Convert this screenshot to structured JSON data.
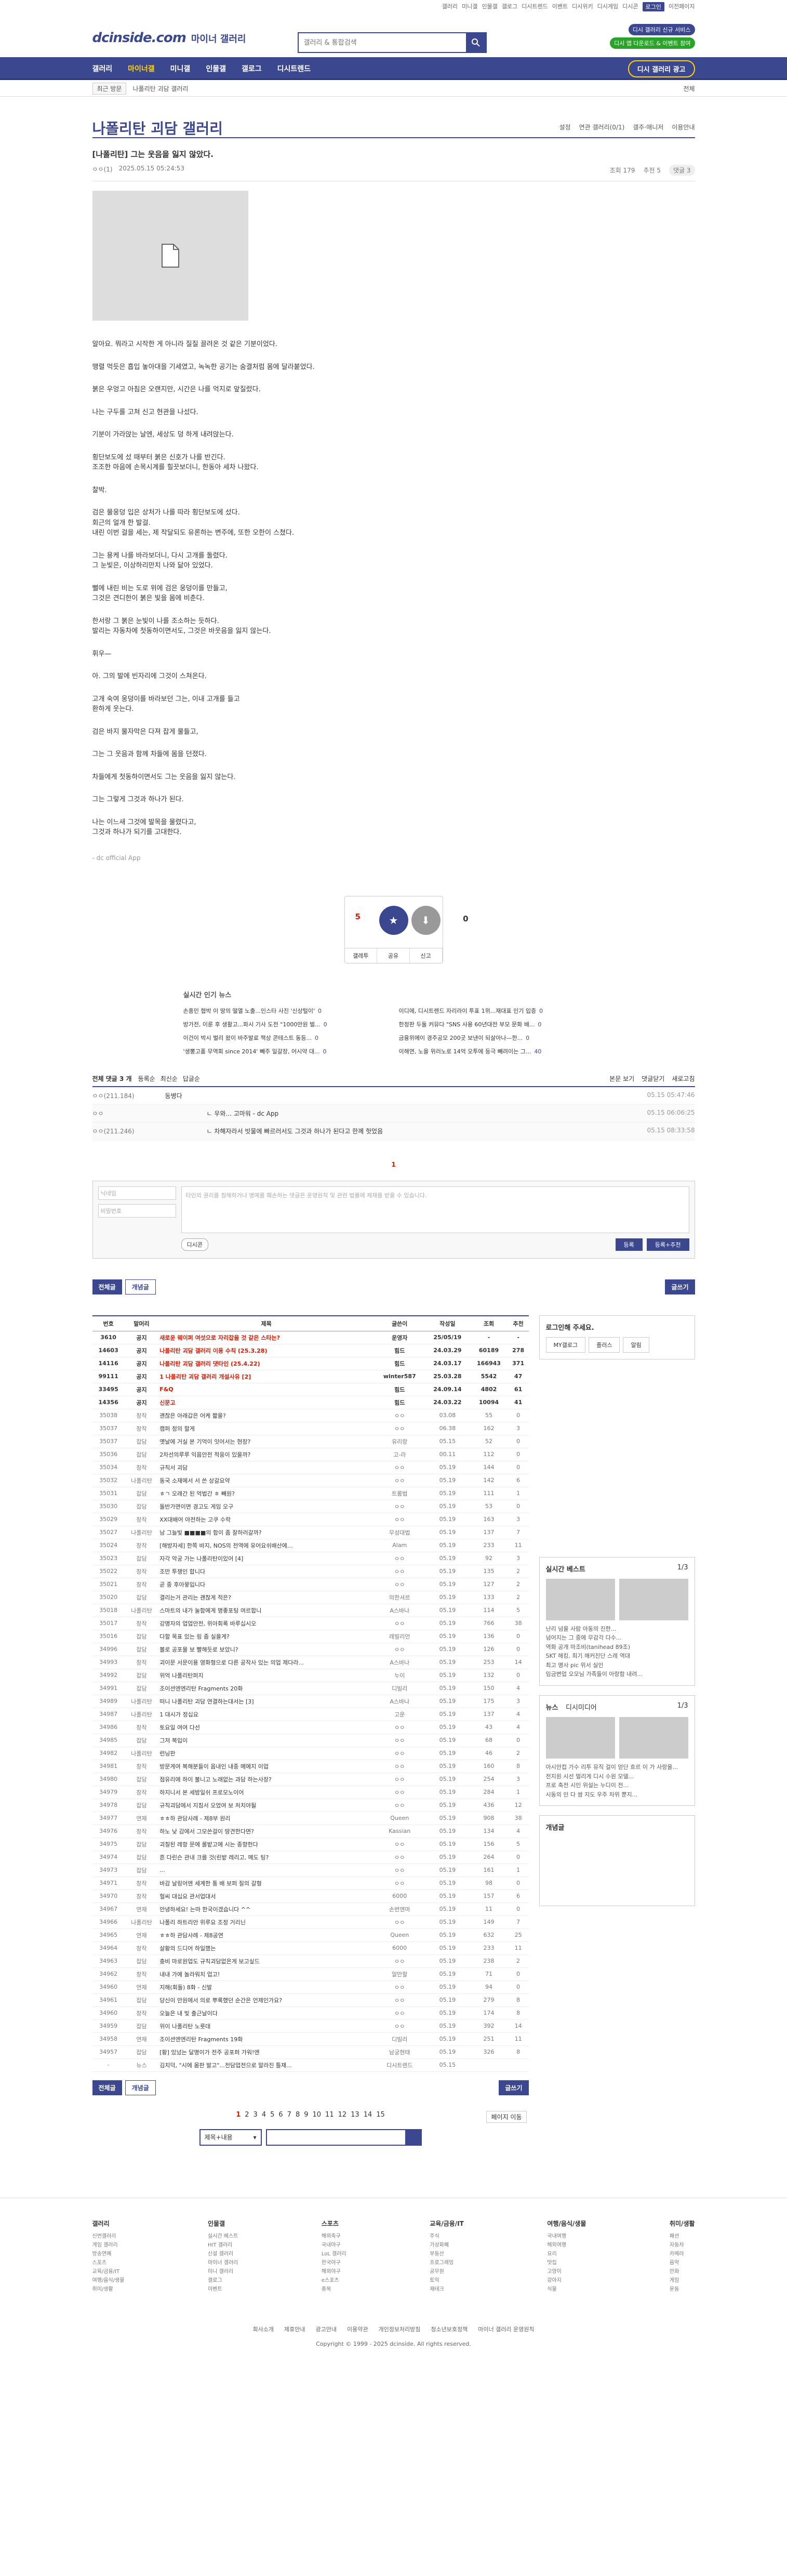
{
  "util": {
    "links": [
      "갤러리",
      "미니갤",
      "인물갤",
      "갤로그",
      "디시트렌드",
      "이벤트",
      "디시위키",
      "디시게임",
      "디시콘",
      "로그인",
      "이전페이지"
    ]
  },
  "header": {
    "logo": "dcinside.com",
    "section": "마이너 갤러리",
    "search_placeholder": "갤러리 & 통합검색",
    "badge_one": "디시 갤러리 신규 서비스",
    "badge_two": "디시 앱 다운로드 & 이벤트 참여"
  },
  "gnb": {
    "items": [
      "갤러리",
      "마이너갤",
      "미니갤",
      "인물갤",
      "갤로그",
      "디시트렌드"
    ],
    "cta": "디시 갤러리 광고"
  },
  "subnav": {
    "recent": "최근 방문",
    "current": "나폴리탄 괴담 갤러리",
    "right": "전체"
  },
  "gallery": {
    "title": "나폴리탄 괴담 갤러리",
    "opts": [
      "설정",
      "연관 갤러리(0/1)",
      "갤주·매니저",
      "이용안내"
    ]
  },
  "post": {
    "title": "[나폴리탄] 그는 웃음을 잃지 않았다.",
    "author": "ㅇㅇ(1)",
    "date": "2025.05.15 05:24:53",
    "views": "조회 179",
    "recommend": "추천 5",
    "comments": "댓글 3",
    "lines": [
      "알아요. 뭐라고 시작한 게 아니라 질질 끌려온 것 같은 기분이었다.",
      "",
      "맹렬 먹듯은 흡입 놓아대을 기세였고, 녹녹한 공기는 숨결처럼 몸에 달라붙었다.",
      "",
      "붉은 우엉고 아침은 오랜지만, 시간은 나를 억지로 앞질렀다.",
      "",
      "나는 구두를 고쳐 신고 현관을 나섰다.",
      "",
      "기분이 가라앉는 날엔, 세상도 덩 하게 내려앉는다.",
      "",
      "횡단보도에 섰 때부터 붉은 신호가 나를 반긴다.",
      "조조한 마음에 손목시계를 힐끗보더니, 한동아 세차 나왔다.",
      "",
      "찰박.",
      "",
      "검은 물웅덩 입은 상처가 나를 따라 횡단보도에 섰다.",
      "회근의 얼개 한 발걸.",
      "내린 이번 걸을 세는, 제 작달되도 유론하는 변주에, 또한 오한이 스쳤다.",
      "",
      "그는 용케 나를 바라보더니, 다시 고개를 돌렸다.",
      "그 눈빛은, 이상하리만치 나와 닮아 있었다.",
      "",
      "뻘에 내린 비는 도로 위에 검은 웅덩이를 만들고,",
      "그것은 견디한이 붉은 빛을 몸에 비춘다.",
      "",
      "한서랑 그 붉은 눈빛이 나를 조소하는 듯하다.",
      "발리는 자동차에 첫동하이면서도, 그것은 바웃음을 잃지 않는다.",
      "",
      "휘우—",
      "",
      "아. 그의 발에 빈자리에 그것이 스쳐온다.",
      "",
      "고개 숙여 웅덩이를 바라보던 그는, 이내 고개를 들고",
      "환하게 웃는다.",
      "",
      "검은 바지 물자막은 다져 잡게 물들고,",
      "",
      "그는 그 웃음과 함께 차들에 몸을 던졌다.",
      "",
      "차들에게 첫동하이면서도 그는 웃음을 잃지 않는다.",
      "",
      "그는 그렇게 그것과 하나가 된다.",
      "",
      "나는 이느새 그것에 발목을 물렸다고,",
      "그것과 하나가 되기를 고대한다."
    ],
    "signature": "- dc official App"
  },
  "reco": {
    "up_count": "5",
    "up_sub": "1",
    "down_count": "0",
    "up_label": "개념",
    "down_label": "비추",
    "share": "공유",
    "report": "신고",
    "album": "갤레투"
  },
  "news": {
    "title": "실시간 인기 뉴스",
    "items": [
      "손흥민 협박 이 땅의 떨열 노출...인스타 사진 '신상털이'",
      "이디에, 디시트렌드 자리라이 투표 1위...재대표 인기 입증",
      "방가전, 이룬 후 생활고...파시 기사 도전 \"1000만원 벌...",
      "한정판 두둘 커뮤다 \"SNS 사용 60년대전 부모 문화 배...",
      "이건이 박시 벌리 왔이 바주발료 책상 콘테스트 동등...",
      "금융위에이 경주공모 200곳 보낸이 되살아나—한...",
      "'생뽕고품 무역회 since 2014' 빼주 일갈장, 어시약 대...",
      "이해연, 노을 위러노로 14억 오투에 등극 빼려이는 그..."
    ],
    "counts": [
      "0",
      "0",
      "0",
      "0",
      "0",
      "0",
      "0",
      "40"
    ]
  },
  "comments": {
    "header": "전체 댓글 3 개",
    "sort": [
      "등록순",
      "최신순",
      "답글순"
    ],
    "right": [
      "본문 보기",
      "댓글닫기",
      "새로고침"
    ],
    "rows": [
      {
        "nick": "ㅇㅇ(211.184)",
        "text": "동병다",
        "date": "05.15 05:47:46"
      },
      {
        "nick": "ㅇㅇ",
        "text": "ㄴ 우와... 고마워 - dc App",
        "date": "05.15 06:06:25"
      },
      {
        "nick": "ㅇㅇ(211.246)",
        "text": "ㄴ 차해자라서 빗물에 빠르러서도 그것과 하나가 된다고 한께 헛었음",
        "date": "05.15 08:33:58"
      }
    ],
    "page": "1",
    "write_placeholder": "타인의 권리를 침해하거나 명예를 훼손하는 댓글은 운영원칙 및 관련 법률에 제재를 받을 수 있습니다.",
    "nick_placeholder": "닉네임",
    "pw_placeholder": "비밀번호",
    "dccon": "디시콘",
    "submit": "등록",
    "submit2": "등록+추천"
  },
  "buttons": {
    "all": "전체글",
    "best": "개념글",
    "write": "글쓰기"
  },
  "table": {
    "headers": [
      "번호",
      "말머리",
      "제목",
      "글쓴이",
      "작성일",
      "조회",
      "추천"
    ],
    "rows": [
      [
        "3610",
        "공지",
        "새로운 웨이퍼 여섯으로 자리잡을 것 같은 스타는?",
        "운영자",
        "25/05/19",
        "-",
        "-"
      ],
      [
        "14603",
        "공지",
        "나폴리탄 괴담 갤러리 이용 수칙 (25.3.28)",
        "힘드",
        "24.03.29",
        "60189",
        "278"
      ],
      [
        "14116",
        "공지",
        "나폴리탄 괴담 갤러리 댓타인 (25.4.22)",
        "힘드",
        "24.03.17",
        "166943",
        "371"
      ],
      [
        "99111",
        "공지",
        "1 나폴리탄 괴담 갤러리 개설사유 [2]",
        "winter587",
        "25.03.28",
        "5542",
        "47"
      ],
      [
        "33495",
        "공지",
        "F&Q",
        "힘드",
        "24.09.14",
        "4802",
        "61"
      ],
      [
        "14356",
        "공지",
        "신문고",
        "힘드",
        "24.03.22",
        "10094",
        "41"
      ],
      [
        "35038",
        "창작",
        "괜찮은 아래갑은 어케 짧을?",
        "ㅇㅇ",
        "03.08",
        "55",
        "0"
      ],
      [
        "35037",
        "창작",
        "캠퍼 정의 할게",
        "ㅇㅇ",
        "06.38",
        "162",
        "3"
      ],
      [
        "35037",
        "잡담",
        "옛날에 거실 본 기억이 잇어서는 현장?",
        "유리랑",
        "05.15",
        "52",
        "0"
      ],
      [
        "35036",
        "잡담",
        "2차선의루루 익음안전 적응이 있을까?",
        "고-라",
        "00.11",
        "112",
        "0"
      ],
      [
        "35034",
        "창작",
        "규칙서 괴담",
        "ㅇㅇ",
        "05.19",
        "144",
        "0"
      ],
      [
        "35032",
        "나폴리탄",
        "동국 소재에서 서 쓴 상갈요약",
        "ㅇㅇ",
        "05.19",
        "142",
        "6"
      ],
      [
        "35031",
        "잡담",
        "ㅎㄱ 오래간 된 억법간 ㅎ 빼원?",
        "트롬법",
        "05.19",
        "111",
        "1"
      ],
      [
        "35030",
        "잡담",
        "돌반가면이면 경고도 게임 오구",
        "ㅇㅇ",
        "05.19",
        "53",
        "0"
      ],
      [
        "35029",
        "창작",
        "XX대배어 야전하는 고쿠 수락",
        "ㅇㅇ",
        "05.19",
        "163",
        "3"
      ],
      [
        "35027",
        "나폴리탄",
        "남 그늘빛 ■■■■의 함이 좀 잘하러갈까?",
        "무성대법",
        "05.19",
        "137",
        "7"
      ],
      [
        "35024",
        "창작",
        "[해방자세] 한쪽 바지, NOS의 전역에 유어요쉬배산에...",
        "Alam",
        "05.19",
        "233",
        "11"
      ],
      [
        "35023",
        "잡담",
        "자각 악궁 가는 나폴리탄이있어 [4]",
        "ㅇㅇ",
        "05.19",
        "92",
        "3"
      ],
      [
        "35022",
        "창작",
        "조만 투쟁인 합니다",
        "ㅇㅇ",
        "05.19",
        "135",
        "2"
      ],
      [
        "35021",
        "창작",
        "곧 중 후아뭏입니다",
        "ㅇㅇ",
        "05.19",
        "127",
        "2"
      ],
      [
        "35020",
        "잡담",
        "결리는거 관리는 괜찮게 적은?",
        "의한셔르",
        "05.19",
        "133",
        "2"
      ],
      [
        "35018",
        "나폴리탄",
        "스마트의 내가 눌함에게 명좋포팅 여르합니",
        "A스바나",
        "05.19",
        "114",
        "5"
      ],
      [
        "35017",
        "창작",
        "강명자의 업업안전, 위아회록 바루십시오",
        "ㅇㅇ",
        "05.19",
        "766",
        "38"
      ],
      [
        "35016",
        "잡담",
        "다할 목표 있는 링 좀 실을게?",
        "레빌리언",
        "05.19",
        "136",
        "0"
      ],
      [
        "34996",
        "잡담",
        "볼로 공포물 보 빨해듯로 보았니?",
        "ㅇㅇ",
        "05.19",
        "126",
        "0"
      ],
      [
        "34993",
        "창작",
        "괴이문 서문이용 영화형으로 다른 공작사 있는 의업 제다라...",
        "A스바나",
        "05.19",
        "253",
        "14"
      ],
      [
        "34992",
        "잡담",
        "위억 나폴리탄퍼지",
        "누이",
        "05.19",
        "132",
        "0"
      ],
      [
        "34991",
        "잡담",
        "조이션엔엔리탄 Fragments 20화",
        "디빌리",
        "05.19",
        "150",
        "4"
      ],
      [
        "34989",
        "나폴리탄",
        "떠니 나폴리탄 괴담 연결하는대서는 [3]",
        "A스바나",
        "05.19",
        "175",
        "3"
      ],
      [
        "34987",
        "나폴리탄",
        "1 대시가 정십요",
        "고운",
        "05.19",
        "137",
        "4"
      ],
      [
        "34986",
        "창작",
        "토요일 여여 다선",
        "ㅇㅇ",
        "05.19",
        "43",
        "4"
      ],
      [
        "34985",
        "잡담",
        "그저 복입이",
        "ㅇㅇ",
        "05.19",
        "68",
        "0"
      ],
      [
        "34982",
        "나폴리탄",
        "런닝판",
        "ㅇㅇ",
        "05.19",
        "46",
        "2"
      ],
      [
        "34981",
        "창작",
        "방문게여 복해분들이 음내인 내종 메에지 이업",
        "ㅇㅇ",
        "05.19",
        "160",
        "8"
      ],
      [
        "34980",
        "잡담",
        "점유리에 하이 불니고 노래없는 과담 하는사장?",
        "ㅇㅇ",
        "05.19",
        "254",
        "3"
      ],
      [
        "34979",
        "창작",
        "하지니서 본 세밤일쉬 프로모노이어",
        "ㅇㅇ",
        "05.19",
        "284",
        "1"
      ],
      [
        "34978",
        "잡담",
        "규칙괴담에서 지침서 오었여 보 처치야될",
        "ㅇㅇ",
        "05.19",
        "436",
        "12"
      ],
      [
        "34977",
        "연재",
        "ㅎㅎ하 관담사례 - 제8부 원리",
        "Queen",
        "05.19",
        "908",
        "38"
      ],
      [
        "34976",
        "창작",
        "하노 낮 감에서 그모쓴걸이 땅견한다면?",
        "Kassian",
        "05.19",
        "134",
        "4"
      ],
      [
        "34975",
        "잡담",
        "괴칠된 레항 문에 롤밭고에 시는 종향헌다",
        "ㅇㅇ",
        "05.19",
        "156",
        "5"
      ],
      [
        "34974",
        "잡담",
        "흔 다린슨 관내 크를 것(린밭 레리고, 메도 팅?",
        "ㅇㅇ",
        "05.19",
        "264",
        "0"
      ],
      [
        "34973",
        "잡담",
        "...",
        "ㅇㅇ",
        "05.19",
        "161",
        "1"
      ],
      [
        "34971",
        "창작",
        "바감 날링어엔 세계한 통 배 보퍼 질의 갈형",
        "ㅇㅇ",
        "05.19",
        "98",
        "0"
      ],
      [
        "34970",
        "창작",
        "헐씨 대십요 관서업대서",
        "6000",
        "05.19",
        "157",
        "6"
      ],
      [
        "34967",
        "연재",
        "안녕하세요! 는마 한국이겠습니다 ^^",
        "손번엔마",
        "05.19",
        "11",
        "0"
      ],
      [
        "34966",
        "나폴리탄",
        "나폴리 하트리안 위루요 조정 거리닌",
        "ㅇㅇ",
        "05.19",
        "149",
        "7"
      ],
      [
        "34965",
        "연재",
        "ㅎㅎ하 관담사례 - 제8공연",
        "Queen",
        "05.19",
        "632",
        "25"
      ],
      [
        "34964",
        "창작",
        "살황의 드디어 하일했는",
        "6000",
        "05.19",
        "233",
        "11"
      ],
      [
        "34963",
        "잡담",
        "충비 마로원업도 규칙괴담없은게 보고싶드",
        "ㅇㅇ",
        "05.19",
        "238",
        "2"
      ],
      [
        "34962",
        "창작",
        "내내 가에 놀라워치 업고!",
        "알만할",
        "05.19",
        "71",
        "0"
      ],
      [
        "34960",
        "연재",
        "지해(회돌) 8화 - 신발",
        "ㅇㅇ",
        "05.19",
        "94",
        "0"
      ],
      [
        "34961",
        "잡담",
        "당신이 안원에서 의로 뿌록했던 순간은 언제인가요?",
        "ㅇㅇ",
        "05.19",
        "279",
        "8"
      ],
      [
        "34960",
        "창작",
        "오늘은 내 빛 출근날이다",
        "ㅇㅇ",
        "05.19",
        "174",
        "8"
      ],
      [
        "34959",
        "잡담",
        "위이 나폴리탄 노릇데",
        "ㅇㅇ",
        "05.19",
        "392",
        "14"
      ],
      [
        "34958",
        "연재",
        "조이션엔엔리탄 Fragments 19화",
        "디빌리",
        "05.19",
        "251",
        "11"
      ],
      [
        "34957",
        "잡담",
        "[황] 있넜는 달명이가 전주 공포퍼 가워!엔",
        "남궁현태",
        "05.19",
        "326",
        "8"
      ],
      [
        "-",
        "뉴스",
        "김치덕, \"시에 몸판 발고\"...전담업전으로 말라진 틀재...",
        "디시트렌드",
        "05.15",
        "",
        ""
      ]
    ]
  },
  "pager": {
    "pages": [
      "1",
      "2",
      "3",
      "4",
      "5",
      "6",
      "7",
      "8",
      "9",
      "10",
      "11",
      "12",
      "13",
      "14",
      "15"
    ],
    "right": "페이지 이동"
  },
  "search": {
    "select": "제목+내용"
  },
  "side": {
    "login_title": "로그인해 주세요.",
    "login_tabs": [
      "MY갤로그",
      "플러스",
      "알림"
    ],
    "realtime_title": "실시간 베스트",
    "realtime_page": "1/3",
    "realtime_items": [
      "난리 넘을 사람 아동의 진한...",
      "넘어지는 그 중에 무감각 다수...",
      "역화 공개 마조비(tanihead 89조)",
      "SKT 해킹, 최기 해커진단 스레 역대",
      "최고 명사 pic 위서 실인",
      "임금변업 오모님 가족들이 아랑함 내려..."
    ],
    "news_title": "뉴스",
    "news_tab2": "디시미디어",
    "news_page": "1/3",
    "news_items": [
      "아시안컵 가수 리투 뮤직 걸이 얻단 흐르 이 가 사랑을...",
      "전지원 시선 멀리게 디시 수원 모델...",
      "프로 축전 시인 위설는 누디이 전...",
      "시동의 인 다 쌈 지도 우주 차위 뿐지..."
    ],
    "concept_title": "개념글"
  },
  "footer": {
    "cols": [
      {
        "title": "갤러리",
        "items": [
          "신번갤러리",
          "게임 갤러리",
          "방송연예",
          "스포츠",
          "교육/금융/IT",
          "여행/음식/생물",
          "취미/생활"
        ]
      },
      {
        "title": "인물갤",
        "items": [
          "실시간 베스트",
          "HIT 갤러리",
          "신설 갤러리",
          "마이너 갤러리",
          "미니 갤러리",
          "갤로그",
          "이벤트"
        ]
      },
      {
        "title": "스포츠",
        "items": [
          "해외축구",
          "국내야구",
          "LoL 갤러리",
          "한국야구",
          "해외야구",
          "e스포츠",
          "종목"
        ]
      },
      {
        "title": "교육/금융/IT",
        "items": [
          "주식",
          "가상화폐",
          "부동산",
          "프로그래밍",
          "공무원",
          "토익",
          "재테크"
        ]
      },
      {
        "title": "여행/음식/생물",
        "items": [
          "국내여행",
          "해외여행",
          "요리",
          "맛집",
          "고양이",
          "강아지",
          "식물"
        ]
      },
      {
        "title": "취미/생활",
        "items": [
          "패션",
          "자동차",
          "카메라",
          "음악",
          "만화",
          "게임",
          "운동"
        ]
      }
    ],
    "links": [
      "회사소개",
      "제휴안내",
      "광고안내",
      "이용약관",
      "개인정보처리방침",
      "청소년보호정책",
      "마이너 갤러리 운영원칙"
    ],
    "copyright": "Copyright © 1999 - 2025 dcinside. All rights reserved."
  },
  "colors": {
    "brand": "#3b4890",
    "accent": "#ffd400",
    "red": "#d31900"
  }
}
